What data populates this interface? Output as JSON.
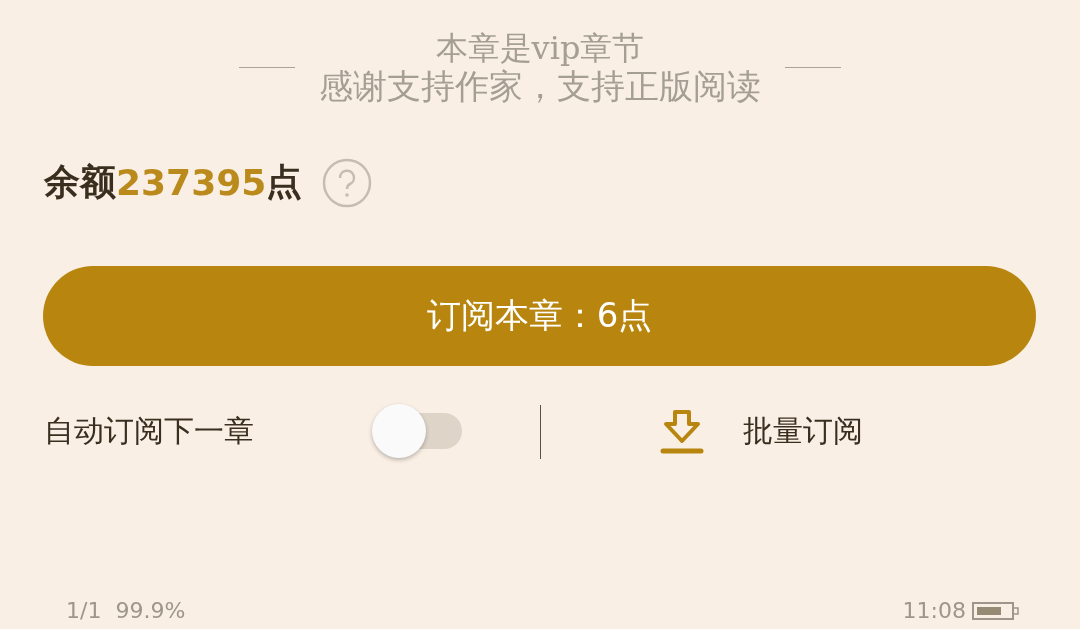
{
  "header": {
    "title": "本章是vip章节",
    "subtitle": "感谢支持作家，支持正版阅读"
  },
  "balance": {
    "label": "余额",
    "amount": "237395",
    "unit": "点"
  },
  "subscribe_button": {
    "label": "订阅本章：6点"
  },
  "auto_subscribe": {
    "label": "自动订阅下一章",
    "on": false
  },
  "bulk_subscribe": {
    "label": "批量订阅"
  },
  "status_bar": {
    "page": "1/1",
    "progress": "99.9%",
    "time": "11:08"
  }
}
